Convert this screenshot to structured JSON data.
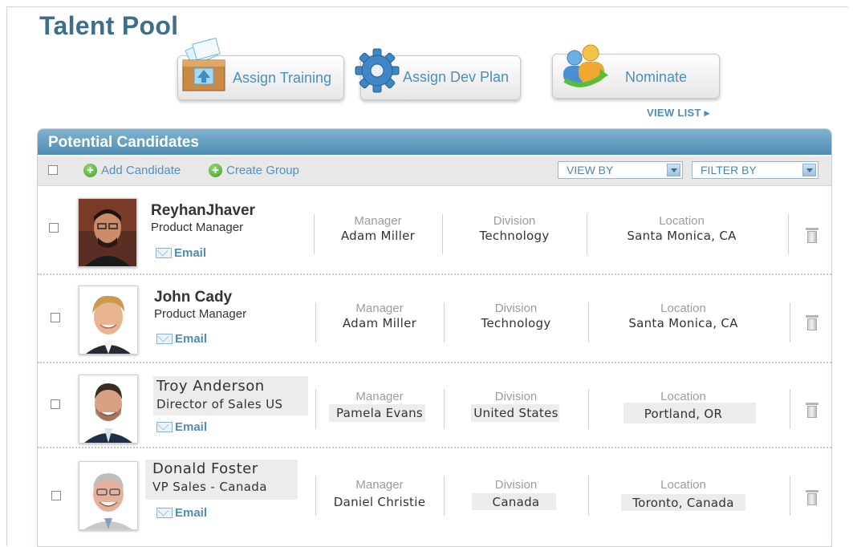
{
  "page": {
    "title": "Talent Pool"
  },
  "actions": {
    "assign_training": "Assign Training",
    "assign_dev_plan": "Assign Dev Plan",
    "nominate": "Nominate",
    "view_list": "VIEW LIST ▸"
  },
  "panel": {
    "title": "Potential Candidates",
    "add_candidate": "Add Candidate",
    "create_group": "Create Group",
    "view_by": "VIEW BY",
    "filter_by": "FILTER BY"
  },
  "labels": {
    "manager": "Manager",
    "division": "Division",
    "location": "Location",
    "email": "Email"
  },
  "candidates": [
    {
      "name": "ReyhanJhaver",
      "role": "Product Manager",
      "manager": "Adam Miller",
      "division": "Technology",
      "location": "Santa Monica, CA"
    },
    {
      "name": "John Cady",
      "role": "Product Manager",
      "manager": "Adam Miller",
      "division": "Technology",
      "location": "Santa Monica, CA"
    },
    {
      "name": "Troy Anderson",
      "role": "Director of Sales US",
      "manager": "Pamela Evans",
      "division": "United States",
      "location": "Portland, OR"
    },
    {
      "name": "Donald Foster",
      "role": "VP Sales - Canada",
      "manager": "Daniel Christie",
      "division": "Canada",
      "location": "Toronto, Canada"
    }
  ],
  "colors": {
    "title": "#3d6f8a",
    "accent": "#4f8db5",
    "header_bar": "#5b97bd",
    "add_green": "#3c9a2c"
  }
}
